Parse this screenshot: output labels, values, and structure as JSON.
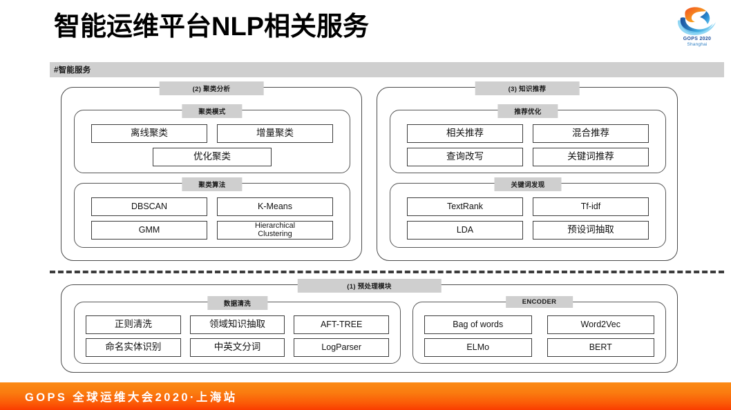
{
  "header": {
    "title": "智能运维平台NLP相关服务",
    "logo": {
      "name": "gops-logo",
      "brand": "GOPS 2020",
      "city": "Shanghai"
    }
  },
  "banner": {
    "label": "#智能服务"
  },
  "sections": {
    "clustering": {
      "label": "(2)  聚类分析",
      "groups": [
        {
          "label": "聚类模式",
          "items": [
            "离线聚类",
            "增量聚类",
            "优化聚类"
          ]
        },
        {
          "label": "聚类算法",
          "items": [
            "DBSCAN",
            "K-Means",
            "GMM",
            "Hierarchical\nClustering"
          ]
        }
      ]
    },
    "knowledge": {
      "label": "(3)   知识推荐",
      "groups": [
        {
          "label": "推荐优化",
          "items": [
            "相关推荐",
            "混合推荐",
            "查询改写",
            "关键词推荐"
          ]
        },
        {
          "label": "关键词发现",
          "items": [
            "TextRank",
            "Tf-idf",
            "LDA",
            "预设词抽取"
          ]
        }
      ]
    },
    "preprocess": {
      "label": "(1)  预处理模块",
      "groups": [
        {
          "label": "数据清洗",
          "items": [
            "正则清洗",
            "领域知识抽取",
            "AFT-TREE",
            "命名实体识别",
            "中英文分词",
            "LogParser"
          ]
        },
        {
          "label": "ENCODER",
          "items": [
            "Bag of words",
            "Word2Vec",
            "ELMo",
            "BERT"
          ]
        }
      ]
    }
  },
  "footer": {
    "text": "GOPS 全球运维大会2020·上海站"
  },
  "colors": {
    "banner_gray": "#cfcfcf",
    "border_dark": "#4a4a4a",
    "footer_orange_top": "#fb8b16",
    "footer_orange_bottom": "#fa3c00",
    "logo_blue": "#1f4e9c"
  }
}
